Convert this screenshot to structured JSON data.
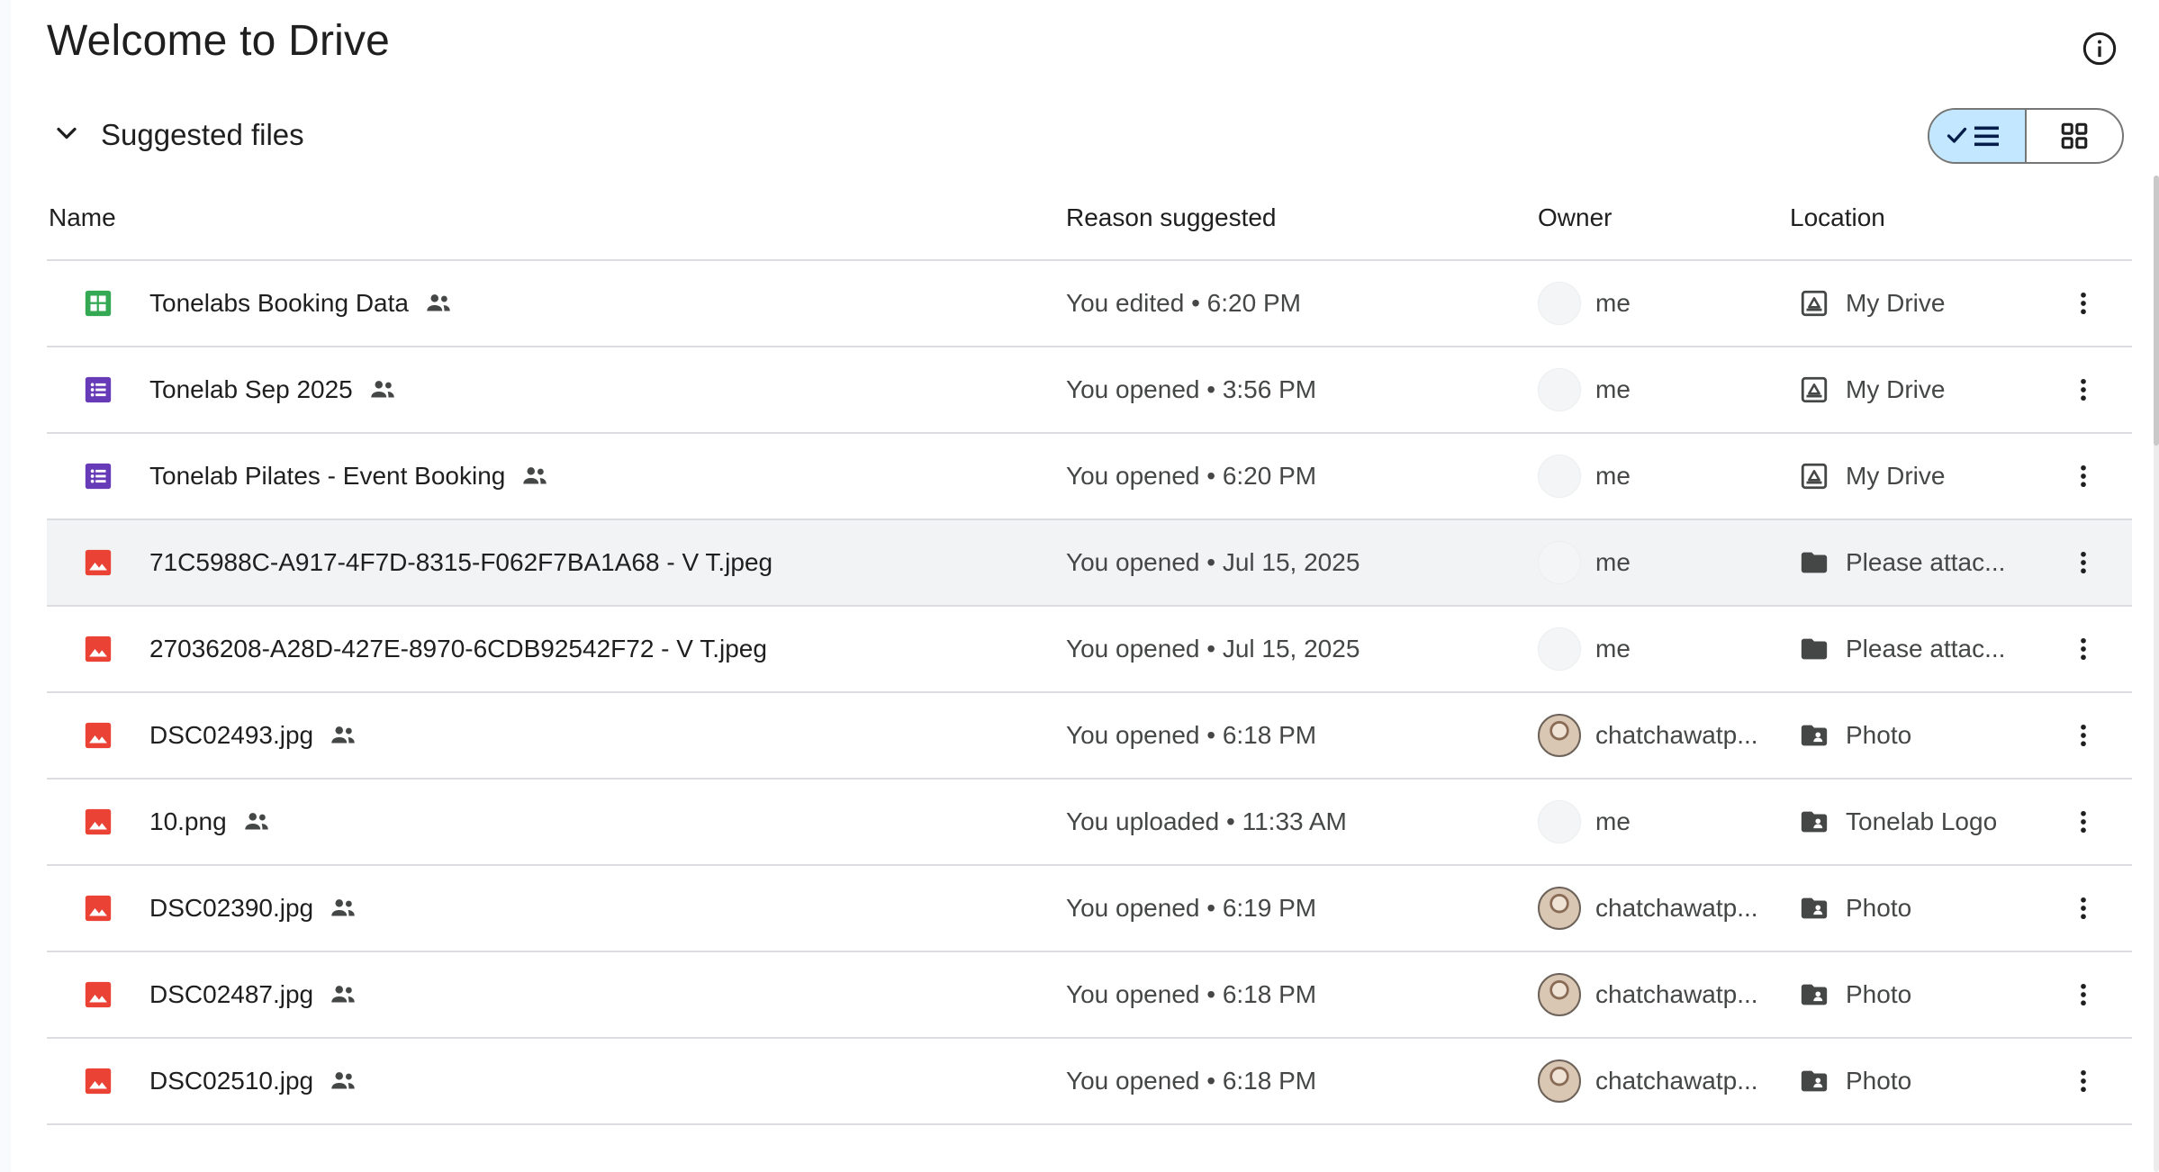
{
  "page": {
    "title": "Welcome to Drive"
  },
  "section": {
    "title": "Suggested files"
  },
  "columns": {
    "name": "Name",
    "reason": "Reason suggested",
    "owner": "Owner",
    "location": "Location"
  },
  "files": [
    {
      "name": "Tonelabs Booking Data",
      "type": "sheets-icon",
      "shared": true,
      "reason": "You edited • 6:20 PM",
      "owner": "me",
      "owner_avatar": "me",
      "location": "My Drive",
      "location_icon": "my-drive-icon"
    },
    {
      "name": "Tonelab Sep 2025",
      "type": "forms-icon",
      "shared": true,
      "reason": "You opened • 3:56 PM",
      "owner": "me",
      "owner_avatar": "me",
      "location": "My Drive",
      "location_icon": "my-drive-icon"
    },
    {
      "name": "Tonelab Pilates - Event Booking",
      "type": "forms-icon",
      "shared": true,
      "reason": "You opened • 6:20 PM",
      "owner": "me",
      "owner_avatar": "me",
      "location": "My Drive",
      "location_icon": "my-drive-icon"
    },
    {
      "name": "71C5988C-A917-4F7D-8315-F062F7BA1A68 - V T.jpeg",
      "type": "image-icon",
      "shared": false,
      "reason": "You opened • Jul 15, 2025",
      "owner": "me",
      "owner_avatar": "me",
      "location": "Please attac...",
      "location_icon": "folder-icon"
    },
    {
      "name": "27036208-A28D-427E-8970-6CDB92542F72 - V T.jpeg",
      "type": "image-icon",
      "shared": false,
      "reason": "You opened • Jul 15, 2025",
      "owner": "me",
      "owner_avatar": "me",
      "location": "Please attac...",
      "location_icon": "folder-icon"
    },
    {
      "name": "DSC02493.jpg",
      "type": "image-icon",
      "shared": true,
      "reason": "You opened • 6:18 PM",
      "owner": "chatchawatp...",
      "owner_avatar": "photo",
      "location": "Photo",
      "location_icon": "shared-folder-icon"
    },
    {
      "name": "10.png",
      "type": "image-icon",
      "shared": true,
      "reason": "You uploaded • 11:33 AM",
      "owner": "me",
      "owner_avatar": "me",
      "location": "Tonelab Logo",
      "location_icon": "shared-folder-icon"
    },
    {
      "name": "DSC02390.jpg",
      "type": "image-icon",
      "shared": true,
      "reason": "You opened • 6:19 PM",
      "owner": "chatchawatp...",
      "owner_avatar": "photo",
      "location": "Photo",
      "location_icon": "shared-folder-icon"
    },
    {
      "name": "DSC02487.jpg",
      "type": "image-icon",
      "shared": true,
      "reason": "You opened • 6:18 PM",
      "owner": "chatchawatp...",
      "owner_avatar": "photo",
      "location": "Photo",
      "location_icon": "shared-folder-icon"
    },
    {
      "name": "DSC02510.jpg",
      "type": "image-icon",
      "shared": true,
      "reason": "You opened • 6:18 PM",
      "owner": "chatchawatp...",
      "owner_avatar": "photo",
      "location": "Photo",
      "location_icon": "shared-folder-icon"
    }
  ],
  "colors": {
    "sheets": "#34a853",
    "forms": "#673ab7",
    "image": "#ea4335",
    "accent": "#c2e7ff"
  }
}
